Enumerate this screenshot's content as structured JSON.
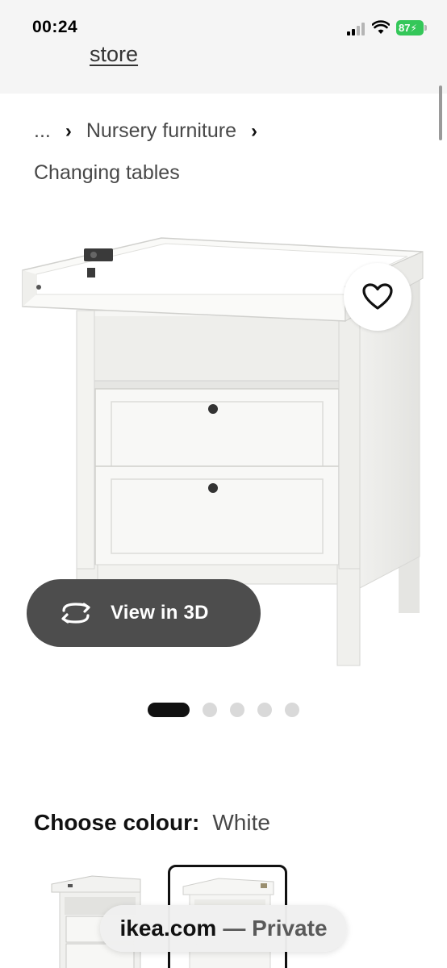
{
  "status_bar": {
    "time": "00:24",
    "battery": "87"
  },
  "nav": {
    "store_link": "store"
  },
  "breadcrumb": {
    "ellipsis": "...",
    "separator": "›",
    "category": "Nursery furniture",
    "current": "Changing tables"
  },
  "product": {
    "favourite_icon": "heart-icon",
    "view_3d_label": "View in 3D",
    "view_3d_icon": "rotate-icon",
    "carousel": {
      "total": 5,
      "active_index": 0
    }
  },
  "colour": {
    "label": "Choose colour:",
    "selected": "White"
  },
  "browser": {
    "domain": "ikea.com",
    "mode": "— Private"
  },
  "colors": {
    "button_dark": "#4d4d4d",
    "battery_green": "#34c759",
    "active_dot": "#111111",
    "inactive_dot": "#d9d9d9"
  }
}
